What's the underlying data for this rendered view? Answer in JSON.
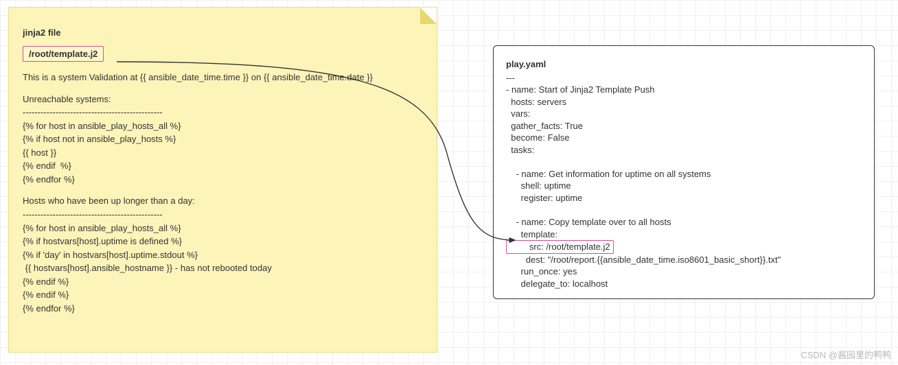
{
  "note": {
    "title": "jinja2 file",
    "path": "/root/template.j2",
    "lines": [
      "This is a system Validation at {{ ansible_date_time.time }} on {{ ansible_date_time.date }}",
      "",
      "Unreachable systems:",
      "-----------------------------------------------",
      "{% for host in ansible_play_hosts_all %}",
      "{% if host not in ansible_play_hosts %}",
      "{{ host }}",
      "{% endif  %}",
      "{% endfor %}",
      "",
      "Hosts who have been up longer than a day:",
      "-----------------------------------------------",
      "{% for host in ansible_play_hosts_all %}",
      "{% if hostvars[host].uptime is defined %}",
      "{% if 'day' in hostvars[host].uptime.stdout %}",
      " {{ hostvars[host].ansible_hostname }} - has not rebooted today",
      "{% endif %}",
      "{% endif %}",
      "{% endfor %}"
    ]
  },
  "yaml": {
    "filename": "play.yaml",
    "lines_before_src": [
      "---",
      "- name: Start of Jinja2 Template Push",
      "  hosts: servers",
      "  vars:",
      "  gather_facts: True",
      "  become: False",
      "  tasks:",
      "",
      "    - name: Get information for uptime on all systems",
      "      shell: uptime",
      "      register: uptime",
      "",
      "    - name: Copy template over to all hosts",
      "      template:"
    ],
    "src_line": "        src: /root/template.j2",
    "lines_after_src": [
      "        dest: \"/root/report.{{ansible_date_time.iso8601_basic_short}}.txt\"",
      "      run_once: yes",
      "      delegate_to: localhost"
    ]
  },
  "watermark": "CSDN @酱园里的鸭鸭"
}
